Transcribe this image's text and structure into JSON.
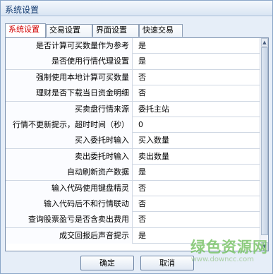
{
  "window": {
    "title": "系统设置"
  },
  "tabs": [
    {
      "label": "系统设置",
      "active": true
    },
    {
      "label": "交易设置",
      "active": false
    },
    {
      "label": "界面设置",
      "active": false
    },
    {
      "label": "快速交易",
      "active": false
    }
  ],
  "settings": [
    {
      "label": "是否计算可买数量作为参考",
      "value": "是"
    },
    {
      "label": "是否使用行情代理设置",
      "value": "是"
    },
    {
      "label": "强制使用本地计算可买数量",
      "value": "否"
    },
    {
      "label": "理财是否下载当日资金明细",
      "value": "否"
    },
    {
      "label": "买卖盘行情来源",
      "value": "委托主站"
    },
    {
      "label": "行情不更新提示，超时时间（秒）",
      "value": "0"
    },
    {
      "label": "买入委托时输入",
      "value": "买入数量"
    },
    {
      "label": "卖出委托时输入",
      "value": "卖出数量"
    },
    {
      "label": "自动刷新资产数据",
      "value": "是"
    },
    {
      "label": "输入代码使用键盘精灵",
      "value": "否"
    },
    {
      "label": "输入代码后不和行情联动",
      "value": "否"
    },
    {
      "label": "查询股票盈亏是否含卖出费用",
      "value": "否"
    },
    {
      "label": "成交回报后声音提示",
      "value": "是"
    }
  ],
  "buttons": {
    "ok": "确定",
    "cancel": "取消"
  },
  "watermark": {
    "main": "绿色资源网",
    "url": "www.downcc.com"
  },
  "colors": {
    "active_tab_text": "#d20000",
    "title_text": "#123a70",
    "watermark": "#7cc56a"
  }
}
